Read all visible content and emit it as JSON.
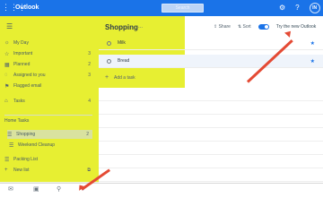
{
  "app": {
    "title": "Outlook",
    "search_placeholder": "Search",
    "accent_color": "#1a73e8",
    "highlight_color": "#e7ef32",
    "arrow_color": "#e44a34"
  },
  "top_icons": [
    {
      "name": "settings-icon",
      "glyph": "⚙"
    },
    {
      "name": "help-icon",
      "glyph": "?"
    },
    {
      "name": "avatar",
      "glyph": "IN"
    }
  ],
  "sidebar": {
    "items": [
      {
        "label": "My Day",
        "icon": "☼",
        "count": ""
      },
      {
        "label": "Important",
        "icon": "☆",
        "count": "3"
      },
      {
        "label": "Planned",
        "icon": "▦",
        "count": "2"
      },
      {
        "label": "Assigned to you",
        "icon": "◌",
        "count": "3"
      },
      {
        "label": "Flagged email",
        "icon": "⚑",
        "count": ""
      },
      {
        "label": "Tasks",
        "icon": "⌂",
        "count": "4"
      }
    ],
    "section_title": "Home Tasks",
    "group_items": [
      {
        "label": "Shopping",
        "icon": "☰",
        "count": "2"
      },
      {
        "label": "Weekend Cleanup",
        "icon": "☰",
        "count": ""
      }
    ],
    "lists": [
      {
        "label": "Packing List",
        "icon": "☰",
        "count": ""
      }
    ],
    "new_list_label": "New list"
  },
  "main": {
    "title": "Shopping",
    "more": "...",
    "toolbar": {
      "share": "Share",
      "sort": "Sort",
      "try_new": "Try the new Outlook"
    },
    "tasks": [
      {
        "title": "Milk",
        "starred": true
      },
      {
        "title": "Bread",
        "starred": true
      }
    ],
    "add_task": "Add a task"
  },
  "bottom_bar": [
    {
      "name": "mail-icon",
      "glyph": "✉"
    },
    {
      "name": "calendar-icon",
      "glyph": "▣"
    },
    {
      "name": "people-icon",
      "glyph": "⚲"
    },
    {
      "name": "todo-icon",
      "glyph": "✓"
    }
  ]
}
